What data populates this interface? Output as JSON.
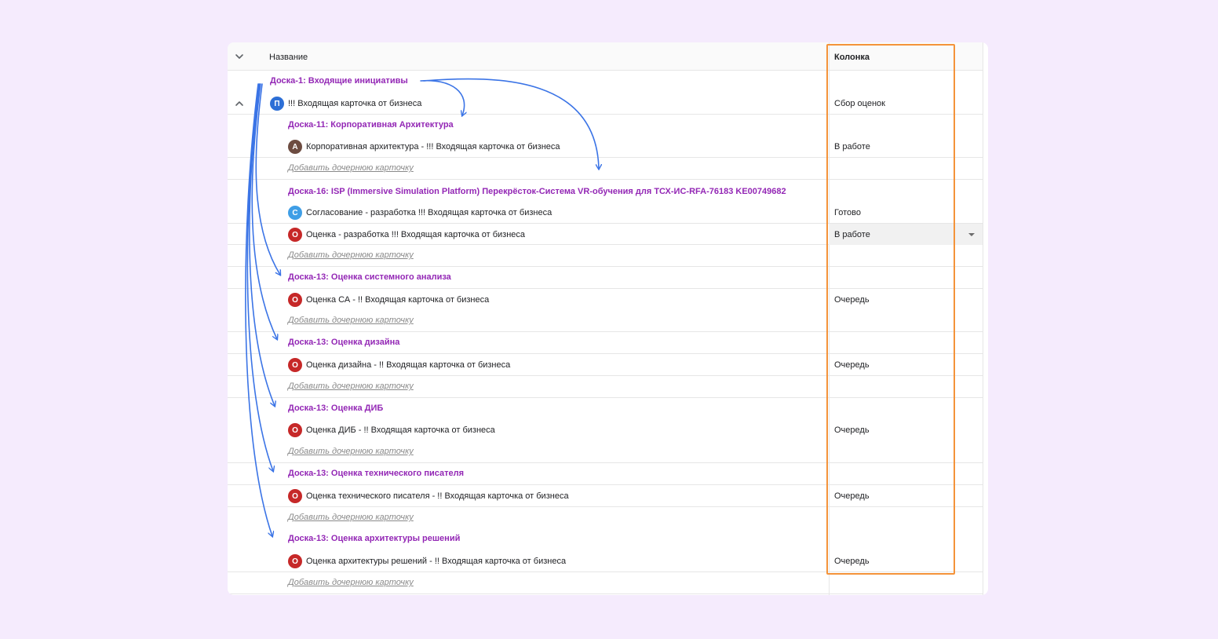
{
  "header": {
    "name_label": "Название",
    "column_label": "Колонка"
  },
  "colors": {
    "board_text": "#9327b5",
    "highlight": "#f4933a",
    "arrow": "#3b74e6"
  },
  "rows": {
    "r0": {
      "text": "Доска-1: Входящие инициативы"
    },
    "r1": {
      "avatar": "П",
      "text": "!!! Входящая карточка от бизнеса",
      "status": "Сбор оценок"
    },
    "r2": {
      "text": "Доска-11: Корпоративная Архитектура"
    },
    "r3": {
      "avatar": "А",
      "text": "Корпоративная архитектура - !!! Входящая карточка от бизнеса",
      "status": "В работе"
    },
    "r4": {
      "text": "Добавить дочернюю карточку"
    },
    "r5": {
      "text": "Доска-16: ISP (Immersive Simulation Platform) Перекрёсток-Система VR-обучения для ТСХ-ИС-RFA-76183 KE00749682"
    },
    "r6": {
      "avatar": "С",
      "text": "Согласование - разработка !!! Входящая карточка от бизнеса",
      "status": "Готово"
    },
    "r7": {
      "avatar": "О",
      "text": "Оценка - разработка !!! Входящая карточка от бизнеса",
      "status": "В работе"
    },
    "r8": {
      "text": "Добавить дочернюю карточку"
    },
    "r9": {
      "text": "Доска-13: Оценка системного анализа"
    },
    "r10": {
      "avatar": "О",
      "text": "Оценка СА - !! Входящая карточка от бизнеса",
      "status": "Очередь"
    },
    "r11": {
      "text": "Добавить дочернюю карточку"
    },
    "r12": {
      "text": "Доска-13: Оценка дизайна"
    },
    "r13": {
      "avatar": "О",
      "text": "Оценка дизайна - !! Входящая карточка от бизнеса",
      "status": "Очередь"
    },
    "r14": {
      "text": "Добавить дочернюю карточку"
    },
    "r15": {
      "text": "Доска-13: Оценка ДИБ"
    },
    "r16": {
      "avatar": "О",
      "text": "Оценка ДИБ - !! Входящая карточка от бизнеса",
      "status": "Очередь"
    },
    "r17": {
      "text": "Добавить дочернюю карточку"
    },
    "r18": {
      "text": "Доска-13: Оценка технического писателя"
    },
    "r19": {
      "avatar": "О",
      "text": "Оценка технического писателя - !! Входящая карточка от бизнеса",
      "status": "Очередь"
    },
    "r20": {
      "text": "Добавить дочернюю карточку"
    },
    "r21": {
      "text": "Доска-13: Оценка архитектуры решений"
    },
    "r22": {
      "avatar": "О",
      "text": "Оценка архитектуры решений - !! Входящая карточка от бизнеса",
      "status": "Очередь"
    },
    "r23": {
      "text": "Добавить дочернюю карточку"
    }
  }
}
